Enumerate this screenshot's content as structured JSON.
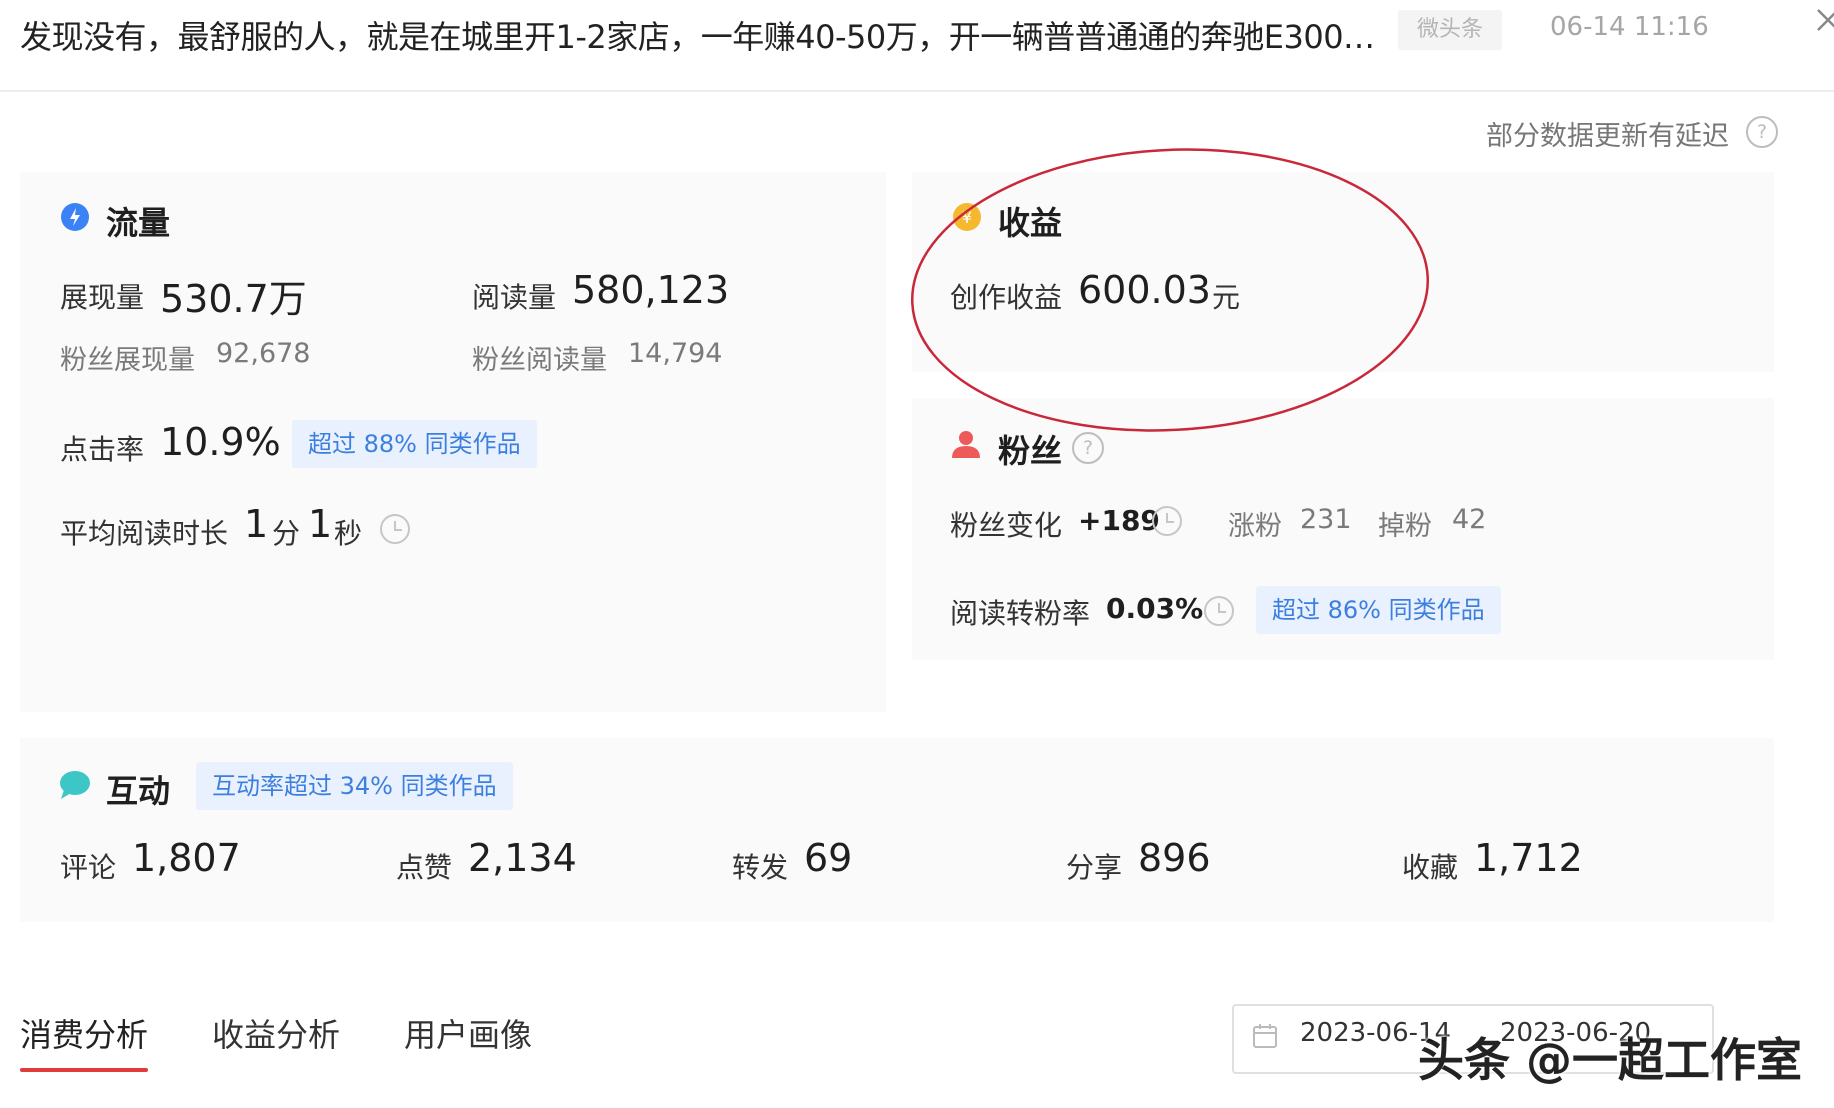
{
  "header": {
    "title": "发现没有，最舒服的人，就是在城里开1-2家店，一年赚40-50万，开一辆普普通通的奔驰E300…",
    "source_tag": "微头条",
    "datetime": "06-14 11:16"
  },
  "delay_notice": "部分数据更新有延迟",
  "traffic": {
    "title": "流量",
    "impressions_label": "展现量",
    "impressions_value": "530.7万",
    "reads_label": "阅读量",
    "reads_value": "580,123",
    "fan_impressions_label": "粉丝展现量",
    "fan_impressions_value": "92,678",
    "fan_reads_label": "粉丝阅读量",
    "fan_reads_value": "14,794",
    "ctr_label": "点击率",
    "ctr_value": "10.9%",
    "ctr_badge": "超过 88% 同类作品",
    "avg_time_label": "平均阅读时长",
    "avg_time_min": "1",
    "avg_time_min_unit": "分",
    "avg_time_sec": "1",
    "avg_time_sec_unit": "秒"
  },
  "revenue": {
    "title": "收益",
    "creation_label": "创作收益",
    "creation_value": "600.03",
    "creation_unit": "元"
  },
  "fans": {
    "title": "粉丝",
    "change_label": "粉丝变化",
    "change_value": "+189",
    "gain_label": "涨粉",
    "gain_value": "231",
    "loss_label": "掉粉",
    "loss_value": "42",
    "conv_label": "阅读转粉率",
    "conv_value": "0.03%",
    "conv_badge": "超过 86% 同类作品"
  },
  "interaction": {
    "title": "互动",
    "badge": "互动率超过 34% 同类作品",
    "metrics": [
      {
        "label": "评论",
        "value": "1,807"
      },
      {
        "label": "点赞",
        "value": "2,134"
      },
      {
        "label": "转发",
        "value": "69"
      },
      {
        "label": "分享",
        "value": "896"
      },
      {
        "label": "收藏",
        "value": "1,712"
      }
    ]
  },
  "tabs": [
    {
      "label": "消费分析"
    },
    {
      "label": "收益分析"
    },
    {
      "label": "用户画像"
    }
  ],
  "date_range": {
    "start": "2023-06-14",
    "end": "2023-06-20"
  },
  "watermark": "头条 @一超工作室",
  "colors": {
    "accent_red": "#e33a3a",
    "badge_blue": "#3d7fe0",
    "annotation_circle": "#c8283a",
    "traffic_icon": "#3b82f6",
    "revenue_icon": "#f5b82e",
    "fans_icon": "#ee5a5a",
    "interaction_icon": "#3cc6c6"
  }
}
